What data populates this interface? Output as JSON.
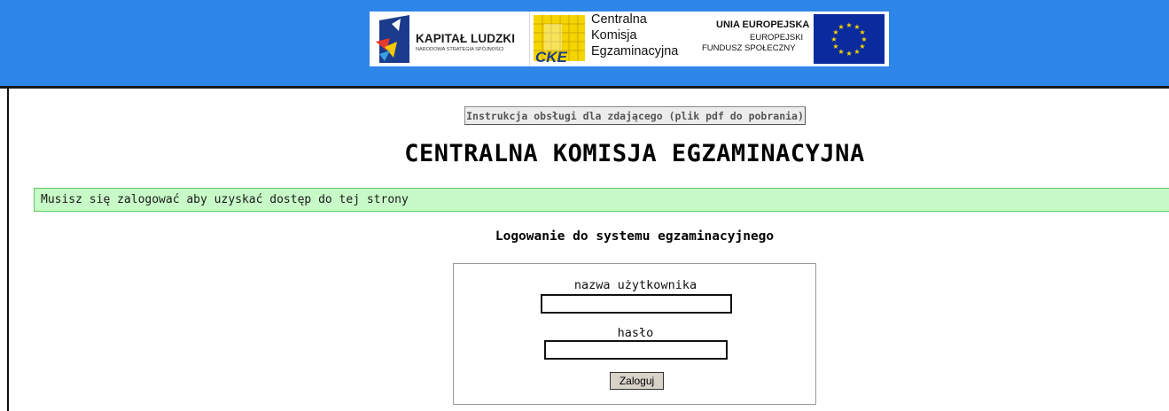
{
  "header": {
    "bg_color": "#2d86e8",
    "logos": {
      "kapital_ludzki": {
        "title": "KAPITAŁ LUDZKI",
        "subtitle": "NARODOWA STRATEGIA SPÓJNOŚCI",
        "icon": "kapital-ludzki-logo"
      },
      "cke": {
        "line1": "Centralna",
        "line2": "Komisja",
        "line3": "Egzaminacyjna",
        "badge": "CKE"
      },
      "eu": {
        "line1": "UNIA EUROPEJSKA",
        "line2": "EUROPEJSKI",
        "line3": "FUNDUSZ SPOŁECZNY",
        "icon": "eu-flag"
      }
    }
  },
  "main": {
    "instructions_button_label": "Instrukcja obsługi dla zdającego (plik pdf do pobrania)",
    "page_title": "CENTRALNA KOMISJA EGZAMINACYJNA",
    "notice_text": "Musisz się zalogować aby uzyskać dostęp do tej strony",
    "notice_color": "#c8fac8"
  },
  "login": {
    "heading": "Logowanie do systemu egzaminacyjnego",
    "username_label": "nazwa użytkownika",
    "username_value": "",
    "password_label": "hasło",
    "password_value": "",
    "submit_label": "Zaloguj"
  }
}
